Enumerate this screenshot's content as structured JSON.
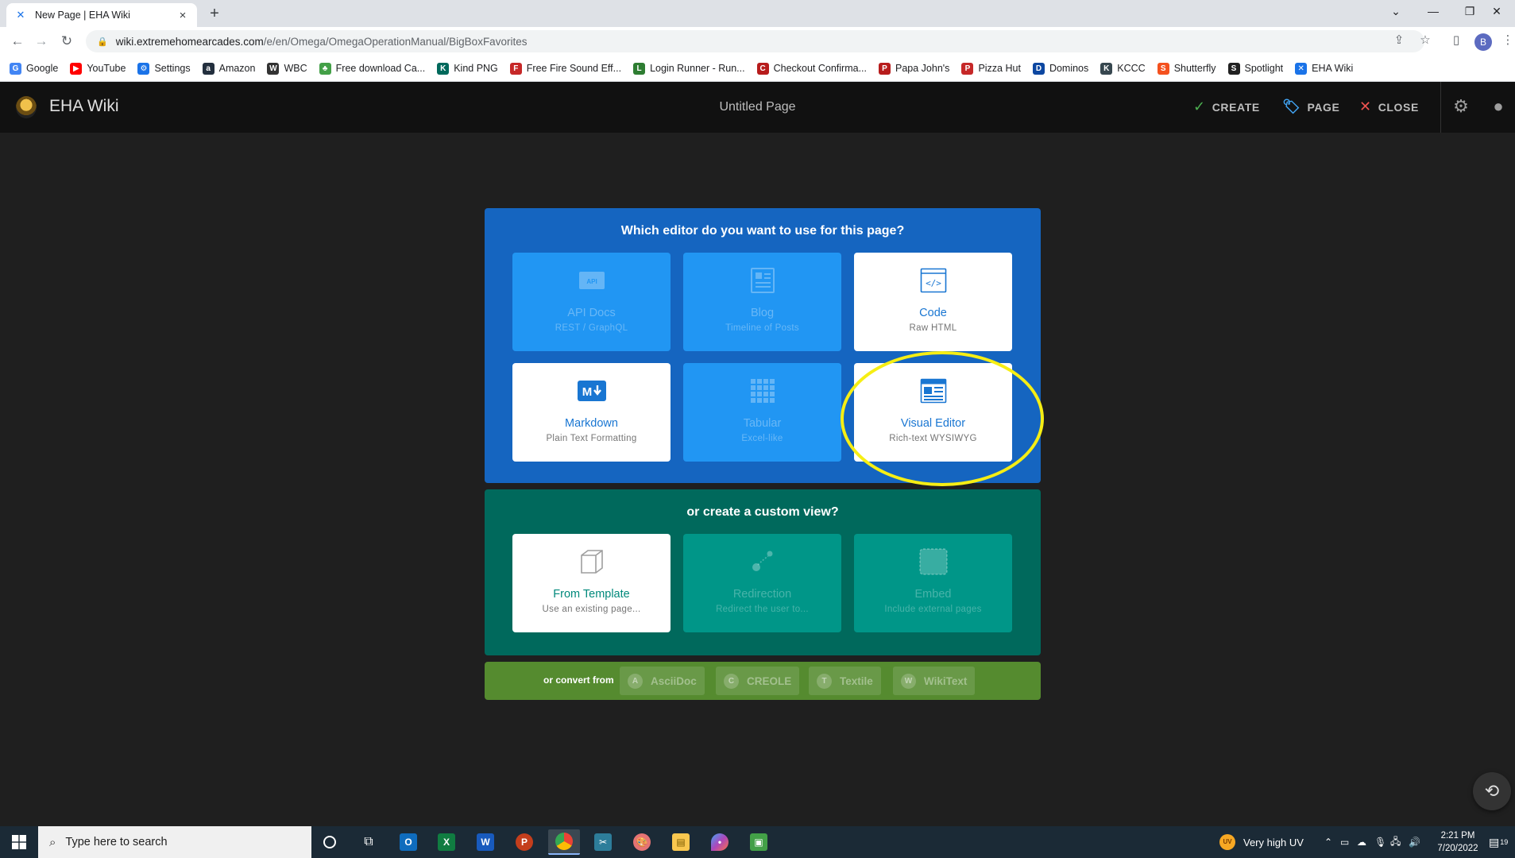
{
  "browser": {
    "tab_title": "New Page | EHA Wiki",
    "url_host": "wiki.extremehomearcades.com",
    "url_path": "/e/en/Omega/OmegaOperationManual/BigBoxFavorites",
    "profile_initial": "B",
    "bookmarks": [
      {
        "label": "Google",
        "icon": "google-icon",
        "color": "#4285f4",
        "glyph": "G"
      },
      {
        "label": "YouTube",
        "icon": "youtube-icon",
        "color": "#ff0000",
        "glyph": "▶"
      },
      {
        "label": "Settings",
        "icon": "gear-icon",
        "color": "#1a73e8",
        "glyph": "⚙"
      },
      {
        "label": "Amazon",
        "icon": "amazon-icon",
        "color": "#232f3e",
        "glyph": "a"
      },
      {
        "label": "WBC",
        "icon": "wbc-icon",
        "color": "#333333",
        "glyph": "W"
      },
      {
        "label": "Free download Ca...",
        "icon": "leaf-icon",
        "color": "#43a047",
        "glyph": "♣"
      },
      {
        "label": "Kind PNG",
        "icon": "kindpng-icon",
        "color": "#00695c",
        "glyph": "K"
      },
      {
        "label": "Free Fire Sound Eff...",
        "icon": "fire-icon",
        "color": "#c62828",
        "glyph": "F"
      },
      {
        "label": "Login Runner - Run...",
        "icon": "runner-icon",
        "color": "#2e7d32",
        "glyph": "L"
      },
      {
        "label": "Checkout Confirma...",
        "icon": "checkout-icon",
        "color": "#b71c1c",
        "glyph": "C"
      },
      {
        "label": "Papa John's",
        "icon": "papajohns-icon",
        "color": "#b71c1c",
        "glyph": "P"
      },
      {
        "label": "Pizza Hut",
        "icon": "pizzahut-icon",
        "color": "#c62828",
        "glyph": "P"
      },
      {
        "label": "Dominos",
        "icon": "dominos-icon",
        "color": "#0d47a1",
        "glyph": "D"
      },
      {
        "label": "KCCC",
        "icon": "kccc-icon",
        "color": "#37474f",
        "glyph": "K"
      },
      {
        "label": "Shutterfly",
        "icon": "shutterfly-icon",
        "color": "#f4511e",
        "glyph": "S"
      },
      {
        "label": "Spotlight",
        "icon": "spotlight-icon",
        "color": "#212121",
        "glyph": "S"
      },
      {
        "label": "EHA Wiki",
        "icon": "wiki-icon",
        "color": "#1a73e8",
        "glyph": "✕"
      }
    ]
  },
  "app": {
    "brand": "EHA Wiki",
    "page_title": "Untitled Page",
    "create_label": "CREATE",
    "page_label": "PAGE",
    "close_label": "CLOSE"
  },
  "editor_select": {
    "question": "Which editor do you want to use for this page?",
    "editors": [
      {
        "name": "API Docs",
        "sub": "REST / GraphQL",
        "enabled": false
      },
      {
        "name": "Blog",
        "sub": "Timeline of Posts",
        "enabled": false
      },
      {
        "name": "Code",
        "sub": "Raw HTML",
        "enabled": true
      },
      {
        "name": "Markdown",
        "sub": "Plain Text Formatting",
        "enabled": true
      },
      {
        "name": "Tabular",
        "sub": "Excel-like",
        "enabled": false
      },
      {
        "name": "Visual Editor",
        "sub": "Rich-text WYSIWYG",
        "enabled": true
      }
    ],
    "custom_question": "or create a custom view?",
    "custom": [
      {
        "name": "From Template",
        "sub": "Use an existing page...",
        "enabled": true
      },
      {
        "name": "Redirection",
        "sub": "Redirect the user to...",
        "enabled": false
      },
      {
        "name": "Embed",
        "sub": "Include external pages",
        "enabled": false
      }
    ],
    "convert_label": "or convert from",
    "convert": [
      {
        "initial": "A",
        "name": "AsciiDoc"
      },
      {
        "initial": "C",
        "name": "CREOLE"
      },
      {
        "initial": "T",
        "name": "Textile"
      },
      {
        "initial": "W",
        "name": "WikiText"
      }
    ]
  },
  "taskbar": {
    "search_placeholder": "Type here to search",
    "weather": "Very high UV",
    "weather_badge": "UV",
    "time": "2:21 PM",
    "date": "7/20/2022",
    "notif_count": "19"
  }
}
